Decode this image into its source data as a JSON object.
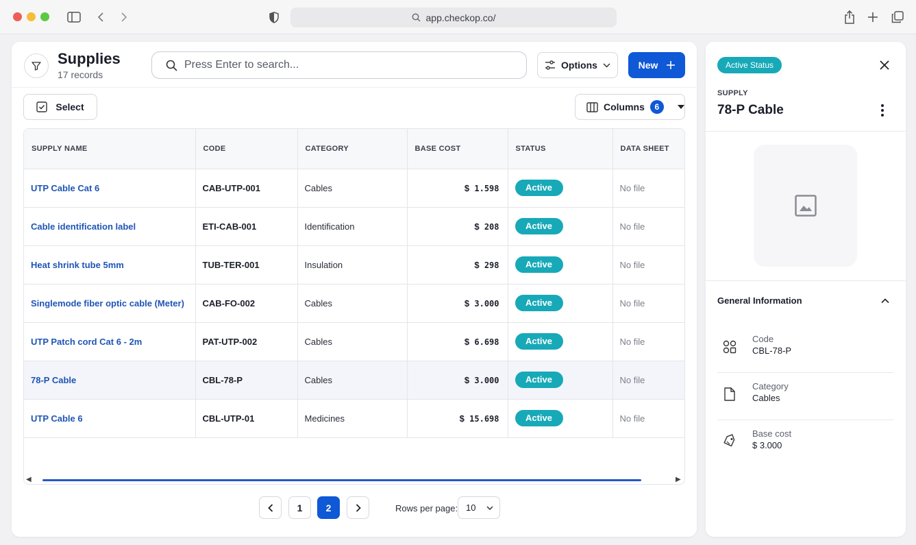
{
  "browser": {
    "url": "app.checkop.co/"
  },
  "header": {
    "title": "Supplies",
    "subtitle": "17 records",
    "search_placeholder": "Press Enter to search...",
    "options_label": "Options",
    "new_label": "New"
  },
  "toolbar": {
    "select_label": "Select",
    "columns_label": "Columns",
    "columns_count": "6"
  },
  "table": {
    "headers": [
      "SUPPLY NAME",
      "CODE",
      "CATEGORY",
      "BASE COST",
      "STATUS",
      "DATA SHEET"
    ],
    "rows": [
      {
        "name": "UTP Cable Cat 6",
        "code": "CAB-UTP-001",
        "category": "Cables",
        "currency": "$",
        "cost": "1.598",
        "status": "Active",
        "data_sheet": "No file"
      },
      {
        "name": "Cable identification label",
        "code": "ETI-CAB-001",
        "category": "Identification",
        "currency": "$",
        "cost": "208",
        "status": "Active",
        "data_sheet": "No file"
      },
      {
        "name": "Heat shrink tube 5mm",
        "code": "TUB-TER-001",
        "category": "Insulation",
        "currency": "$",
        "cost": "298",
        "status": "Active",
        "data_sheet": "No file"
      },
      {
        "name": "Singlemode fiber optic cable (Meter)",
        "code": "CAB-FO-002",
        "category": "Cables",
        "currency": "$",
        "cost": "3.000",
        "status": "Active",
        "data_sheet": "No file"
      },
      {
        "name": "UTP Patch cord Cat 6 - 2m",
        "code": "PAT-UTP-002",
        "category": "Cables",
        "currency": "$",
        "cost": "6.698",
        "status": "Active",
        "data_sheet": "No file"
      },
      {
        "name": "78-P Cable",
        "code": "CBL-78-P",
        "category": "Cables",
        "currency": "$",
        "cost": "3.000",
        "status": "Active",
        "data_sheet": "No file"
      },
      {
        "name": "UTP Cable 6",
        "code": "CBL-UTP-01",
        "category": "Medicines",
        "currency": "$",
        "cost": "15.698",
        "status": "Active",
        "data_sheet": "No file"
      }
    ]
  },
  "pagination": {
    "pages": [
      "1",
      "2"
    ],
    "current_page": "2",
    "rows_label": "Rows per page:",
    "rows_value": "10"
  },
  "panel": {
    "status": "Active Status",
    "type_label": "SUPPLY",
    "name": "78-P Cable",
    "section_title": "General Information",
    "fields": [
      {
        "label": "Code",
        "value": "CBL-78-P",
        "icon": "code-grid-icon"
      },
      {
        "label": "Category",
        "value": "Cables",
        "icon": "document-icon"
      },
      {
        "label": "Base cost",
        "value": "$ 3.000",
        "icon": "price-tag-icon"
      }
    ]
  },
  "colors": {
    "primary": "#0f58d6",
    "status_active": "#17a9b8",
    "link": "#1f55b5"
  }
}
